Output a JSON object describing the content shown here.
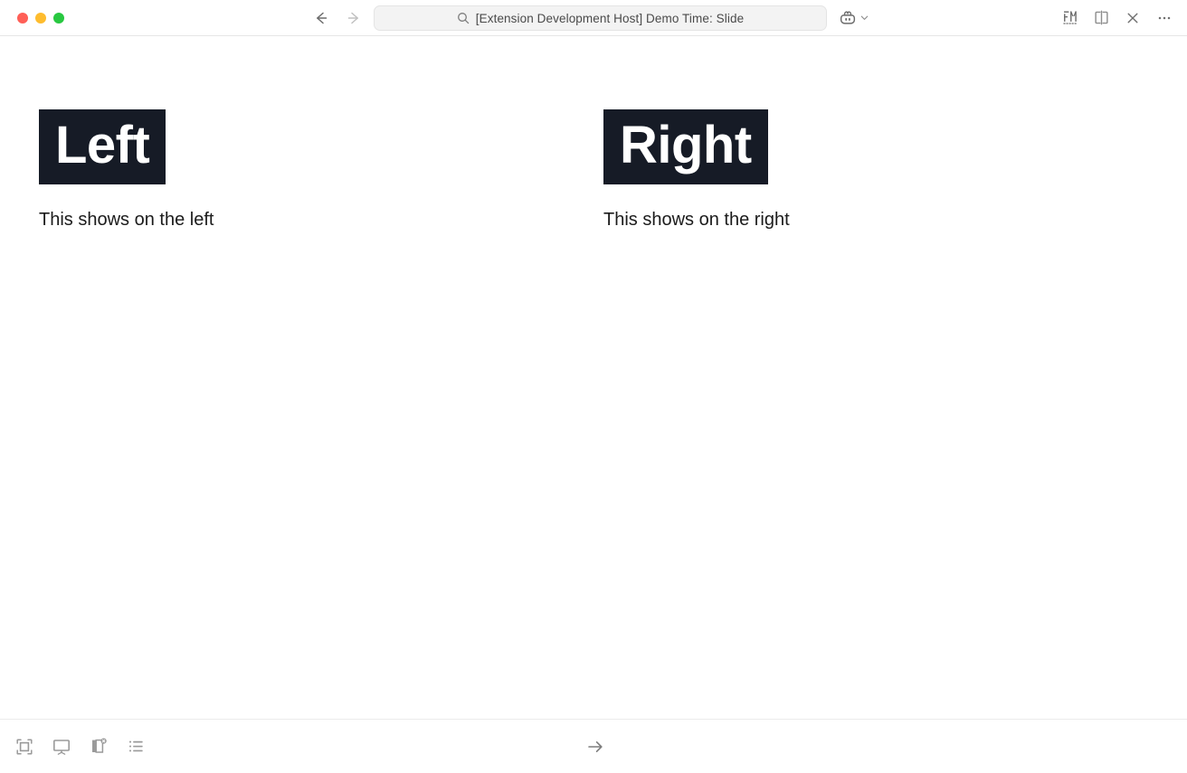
{
  "window": {
    "traffic_lights": [
      {
        "name": "close",
        "color": "#ff5f57"
      },
      {
        "name": "minimize",
        "color": "#febc2e"
      },
      {
        "name": "maximize",
        "color": "#28c840"
      }
    ]
  },
  "titlebar": {
    "back_icon": "arrow-left-icon",
    "forward_icon": "arrow-right-icon",
    "search": {
      "icon": "search-icon",
      "value": "[Extension Development Host] Demo Time: Slide",
      "placeholder": "Search"
    },
    "copilot": {
      "icon": "copilot-icon",
      "chevron": "chevron-down-icon"
    },
    "actions": [
      {
        "name": "format-markdown-icon",
        "label": "FM"
      },
      {
        "name": "split-editor-icon",
        "label": "Split Editor"
      },
      {
        "name": "close-icon",
        "label": "Close"
      },
      {
        "name": "more-actions-icon",
        "label": "More Actions"
      }
    ]
  },
  "slide": {
    "columns": [
      {
        "heading": "Left",
        "body": "This shows on the left",
        "heading_bg": "#161b26",
        "heading_color": "#ffffff"
      },
      {
        "heading": "Right",
        "body": "This shows on the right",
        "heading_bg": "#161b26",
        "heading_color": "#ffffff"
      }
    ]
  },
  "bottombar": {
    "tools": [
      {
        "name": "fit-to-screen-icon",
        "label": "Fit to Screen"
      },
      {
        "name": "present-icon",
        "label": "Present"
      },
      {
        "name": "notes-icon",
        "label": "Speaker Notes",
        "badge": "close-badge"
      },
      {
        "name": "outline-list-icon",
        "label": "Slide List"
      }
    ],
    "next": {
      "name": "next-slide-icon",
      "label": "Next"
    }
  },
  "colors": {
    "background": "#ffffff",
    "titlebar_border": "#e6e6e6",
    "bottombar_border": "#ebebeb",
    "search_bg": "#f3f3f3",
    "icon_gray": "#9a9a9a",
    "text_dark": "#1b1b1b",
    "heading_bg": "#161b26"
  }
}
